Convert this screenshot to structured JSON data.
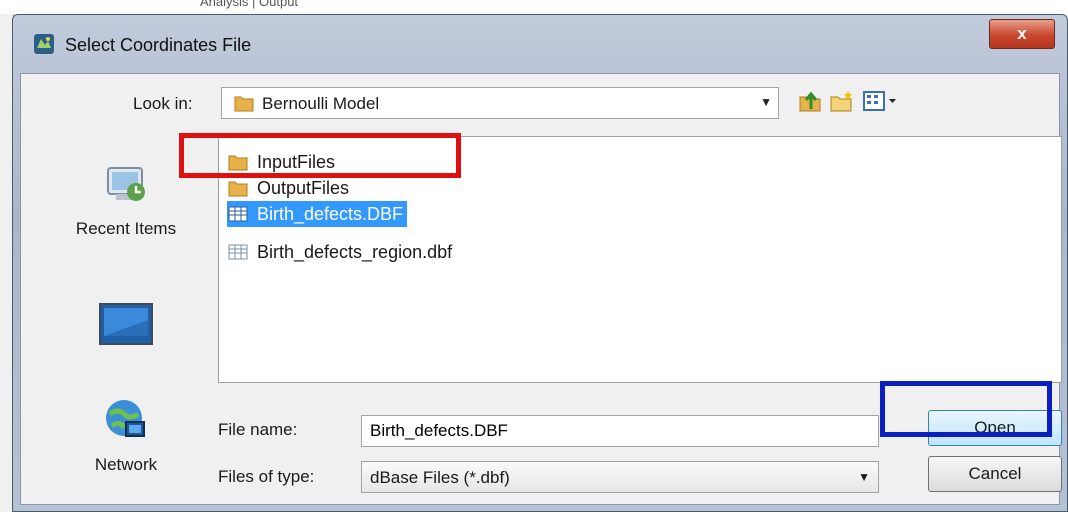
{
  "background": {
    "menu_text": "Analysis  |  Output"
  },
  "dialog": {
    "title": "Select Coordinates File",
    "close_label": "x",
    "look_in": {
      "label": "Look in:",
      "value": "Bernoulli Model"
    },
    "places": [
      {
        "label": "Recent Items",
        "icon": "recent-items-icon"
      },
      {
        "label": "",
        "icon": "desktop-icon"
      },
      {
        "label": "Network",
        "icon": "network-icon"
      }
    ],
    "files": [
      {
        "name": "InputFiles",
        "type": "folder"
      },
      {
        "name": "OutputFiles",
        "type": "folder"
      },
      {
        "name": "Birth_defects.DBF",
        "type": "dbf",
        "selected": true
      },
      {
        "name": "Birth_defects_region.dbf",
        "type": "dbf"
      }
    ],
    "file_name": {
      "label": "File name:",
      "value": "Birth_defects.DBF"
    },
    "file_type": {
      "label": "Files of type:",
      "value": "dBase Files (*.dbf)"
    },
    "buttons": {
      "open": "Open",
      "cancel": "Cancel"
    }
  },
  "colors": {
    "selection": "#3399ff",
    "highlight_red": "#e11010",
    "highlight_blue": "#0a1fbd",
    "folder": "#e8b24a"
  }
}
